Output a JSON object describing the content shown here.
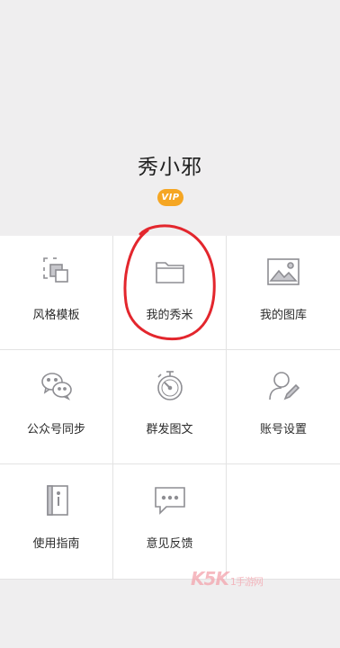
{
  "profile": {
    "username": "秀小邪",
    "badge": "VIP"
  },
  "menu": [
    {
      "label": "风格模板",
      "icon": "template-icon"
    },
    {
      "label": "我的秀米",
      "icon": "folder-icon"
    },
    {
      "label": "我的图库",
      "icon": "image-icon"
    },
    {
      "label": "公众号同步",
      "icon": "wechat-icon"
    },
    {
      "label": "群发图文",
      "icon": "stopwatch-icon"
    },
    {
      "label": "账号设置",
      "icon": "user-edit-icon"
    },
    {
      "label": "使用指南",
      "icon": "guide-book-icon"
    },
    {
      "label": "意见反馈",
      "icon": "feedback-icon"
    }
  ],
  "watermark": {
    "brand": "K5K",
    "suffix": "1手游网"
  },
  "colors": {
    "accent": "#f5a623",
    "highlight": "#e3262d",
    "icon": "#8e8e93"
  }
}
